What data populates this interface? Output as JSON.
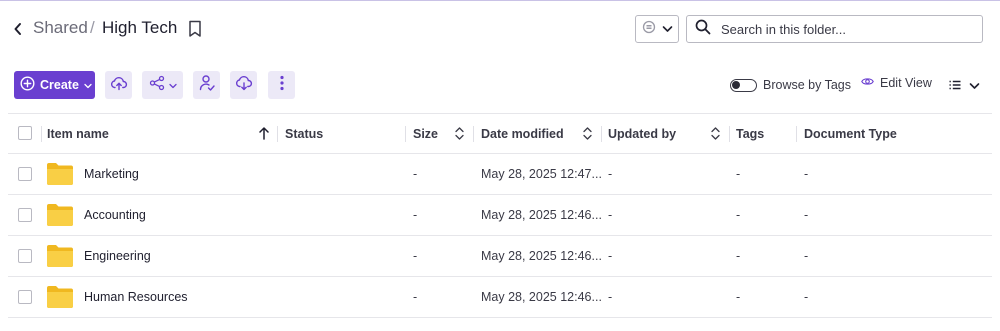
{
  "breadcrumb": {
    "root": "Shared",
    "separator": "/",
    "current": "High Tech"
  },
  "search": {
    "placeholder": "Search in this folder..."
  },
  "toolbar": {
    "create_label": "Create"
  },
  "view": {
    "browse_by_tags_label": "Browse by Tags",
    "browse_by_tags_on": false,
    "edit_view_label": "Edit View"
  },
  "table": {
    "columns": {
      "name": "Item name",
      "status": "Status",
      "size": "Size",
      "date_modified": "Date modified",
      "updated_by": "Updated by",
      "tags": "Tags",
      "document_type": "Document Type"
    },
    "rows": [
      {
        "name": "Marketing",
        "status": "",
        "size": "-",
        "date_modified": "May 28, 2025 12:47...",
        "updated_by": "-",
        "tags": "-",
        "document_type": "-"
      },
      {
        "name": "Accounting",
        "status": "",
        "size": "-",
        "date_modified": "May 28, 2025 12:46...",
        "updated_by": "-",
        "tags": "-",
        "document_type": "-"
      },
      {
        "name": "Engineering",
        "status": "",
        "size": "-",
        "date_modified": "May 28, 2025 12:46...",
        "updated_by": "-",
        "tags": "-",
        "document_type": "-"
      },
      {
        "name": "Human Resources",
        "status": "",
        "size": "-",
        "date_modified": "May 28, 2025 12:46...",
        "updated_by": "-",
        "tags": "-",
        "document_type": "-"
      }
    ]
  },
  "colors": {
    "accent": "#6a3fd0",
    "toolbar_button_bg": "#ece9f7",
    "folder": "#f7c83a",
    "border": "#e6e6ea"
  },
  "icons": [
    "back-arrow-icon",
    "bookmark-icon",
    "scope-icon",
    "chevron-down-icon",
    "search-icon",
    "plus-circle-icon",
    "upload-cloud-icon",
    "share-icon",
    "user-check-icon",
    "download-cloud-icon",
    "more-vertical-icon",
    "eye-icon",
    "list-icon",
    "sort-arrow-up-icon",
    "sort-icon",
    "folder-icon"
  ]
}
